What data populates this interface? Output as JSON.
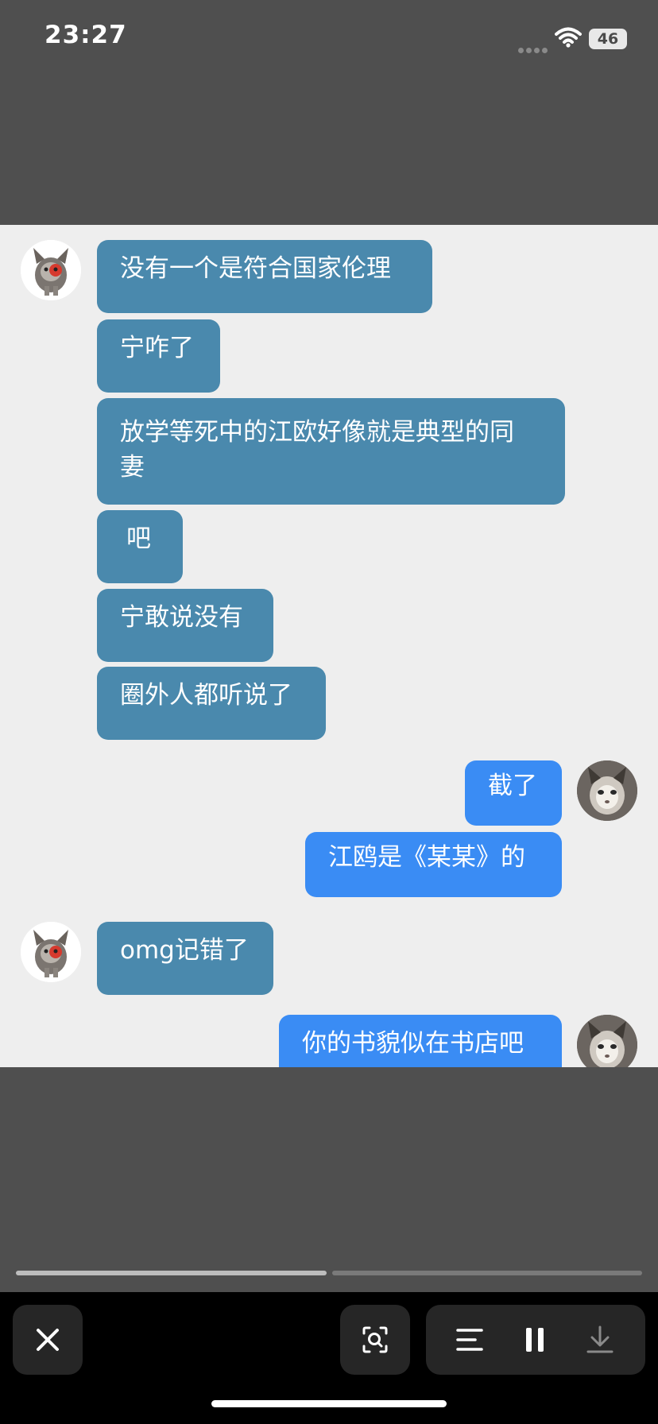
{
  "status_bar": {
    "time": "23:27",
    "battery": "46",
    "icons": [
      "signal-dots-icon",
      "wifi-icon",
      "battery-icon"
    ]
  },
  "messages": [
    {
      "side": "in",
      "text": "没有一个是符合国家伦理"
    },
    {
      "side": "in",
      "text": "宁咋了"
    },
    {
      "side": "in",
      "text": "放学等死中的江欧好像就是典型的同\n妻"
    },
    {
      "side": "in",
      "text": "吧"
    },
    {
      "side": "in",
      "text": "宁敢说没有"
    },
    {
      "side": "in",
      "text": "圈外人都听说了"
    },
    {
      "side": "out",
      "text": "截了"
    },
    {
      "side": "out",
      "text": "江鸥是《某某》的"
    },
    {
      "side": "in",
      "text": "omg记错了"
    },
    {
      "side": "out",
      "text": "你的书貌似在书店吧"
    }
  ],
  "viewer": {
    "progress": [
      1.0,
      0.0
    ],
    "controls": [
      "close-icon",
      "image-search-icon",
      "text-lines-icon",
      "pause-icon",
      "download-icon"
    ]
  },
  "colors": {
    "incoming_bubble": "#4a89ad",
    "outgoing_bubble": "#3a8cf4",
    "chat_background": "#eeeeee",
    "frame_background": "#4f4f4f"
  }
}
